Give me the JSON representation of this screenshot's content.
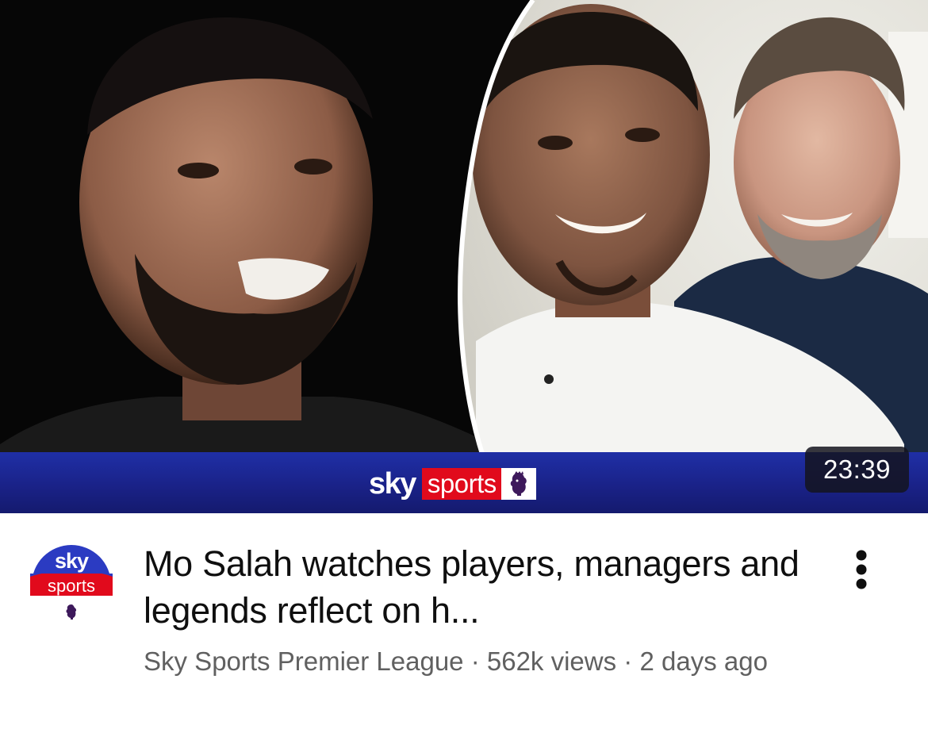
{
  "video": {
    "thumbnail": {
      "description_icon": "video-thumbnail",
      "brand_sky": "sky",
      "brand_sports": "sports",
      "brand_colors": {
        "bar": "#1a2288",
        "sports_red": "#e10a1c"
      },
      "duration": "23:39"
    },
    "channel": {
      "avatar_sky": "sky",
      "avatar_sports": "sports",
      "name": "Sky Sports Premier League"
    },
    "title": "Mo Salah watches players, managers and legends reflect on h...",
    "views": "562k views",
    "age": "2 days ago",
    "separator": "·",
    "more_icon": "more-vert-icon"
  }
}
